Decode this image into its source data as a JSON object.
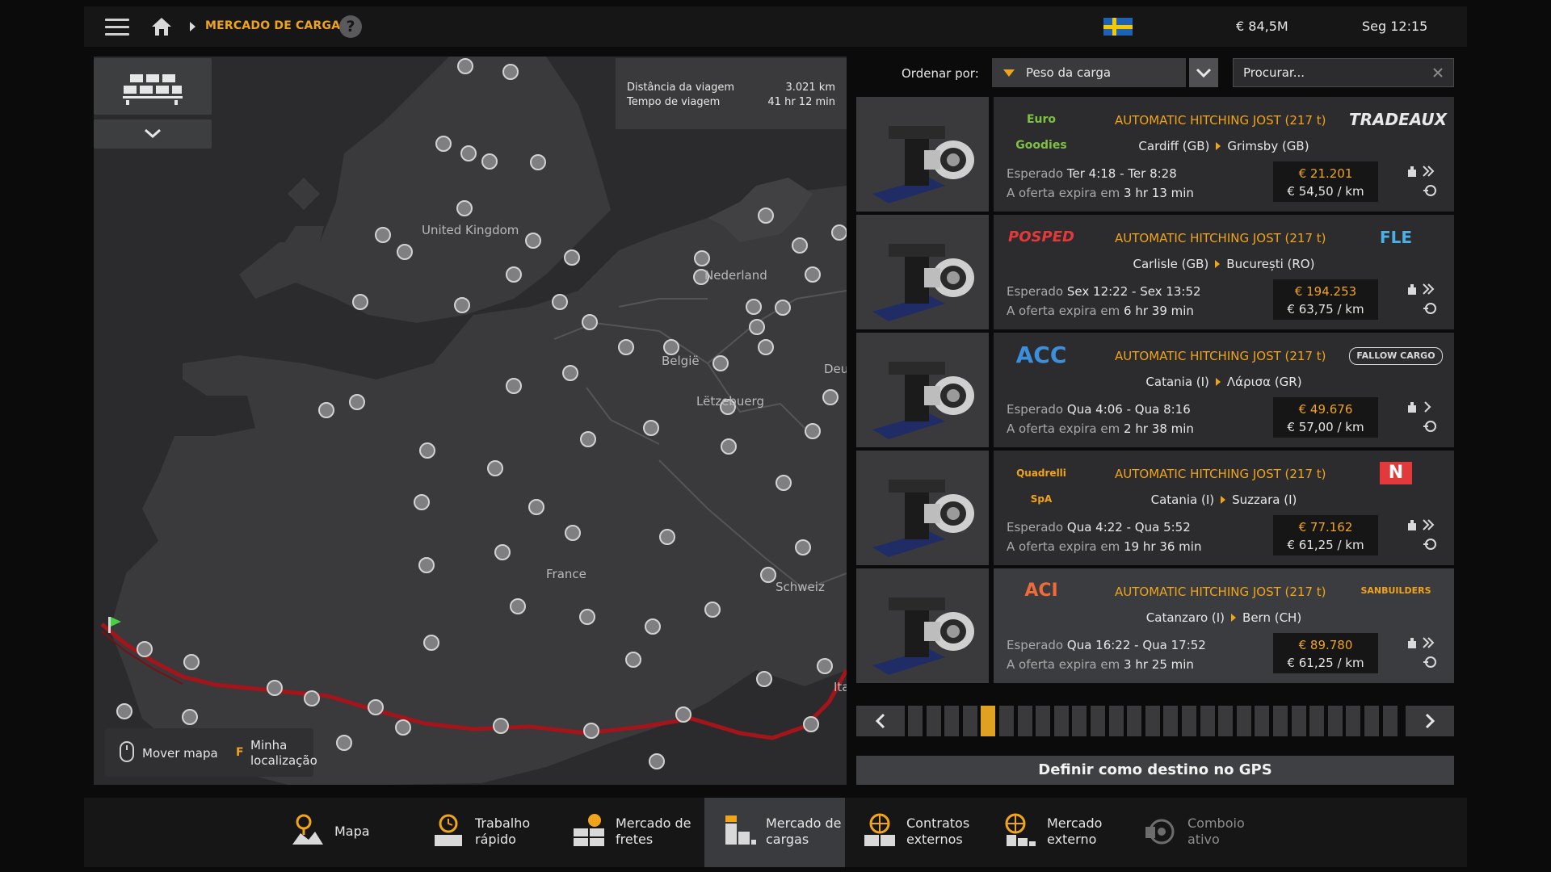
{
  "header": {
    "breadcrumb": "MERCADO DE CARGAS",
    "money": "€ 84,5M",
    "clock": "Seg 12:15"
  },
  "map": {
    "labels": {
      "uk": "United Kingdom",
      "nl": "Nederland",
      "be": "België",
      "lu": "Lëtzebuerg",
      "fr": "France",
      "ch": "Schweiz",
      "de": "Deu",
      "it": "Ita"
    },
    "route_info": {
      "distance_label": "Distância da viagem",
      "distance_value": "3.021 km",
      "time_label": "Tempo de viagem",
      "time_value": "41 hr 12 min"
    },
    "hints": {
      "move": "Mover mapa",
      "key": "F",
      "location": "Minha localização"
    }
  },
  "sort": {
    "label": "Ordenar por:",
    "value": "Peso da carga"
  },
  "search": {
    "placeholder": "Procurar..."
  },
  "jobs": [
    {
      "logo_left": "Euro Goodies",
      "logo_left_color": "#7fc242",
      "cargo": "AUTOMATIC HITCHING JOST (217 t)",
      "from": "Cardiff (GB)",
      "to": "Grimsby (GB)",
      "expected_label": "Esperado",
      "expected": "Ter 4:18 - Ter 8:28",
      "expire_label": "A oferta expira em",
      "expire": "3 hr 13 min",
      "pay": "€ 21.201",
      "per_km": "€ 54,50 / km",
      "logo_right": "TRADEAUX",
      "logo_right_color": "#e8e8e8"
    },
    {
      "logo_left": "POSPED",
      "logo_left_color": "#e23a3a",
      "cargo": "AUTOMATIC HITCHING JOST (217 t)",
      "from": "Carlisle (GB)",
      "to": "București (RO)",
      "expected_label": "Esperado",
      "expected": "Sex 12:22 - Sex 13:52",
      "expire_label": "A oferta expira em",
      "expire": "6 hr 39 min",
      "pay": "€ 194.253",
      "per_km": "€ 63,75 / km",
      "logo_right": "FLE",
      "logo_right_color": "#4ab0e6"
    },
    {
      "logo_left": "ACC",
      "logo_left_color": "#3c8fdc",
      "cargo": "AUTOMATIC HITCHING JOST (217 t)",
      "from": "Catania (I)",
      "to": "Λάρισα (GR)",
      "expected_label": "Esperado",
      "expected": "Qua 4:06 - Qua 8:16",
      "expire_label": "A oferta expira em",
      "expire": "2 hr 38 min",
      "pay": "€ 49.676",
      "per_km": "€ 57,00 / km",
      "logo_right": "FALLOW CARGO",
      "logo_right_color": "#d8d8d8"
    },
    {
      "logo_left": "Quadrelli SpA",
      "logo_left_color": "#f0a41b",
      "cargo": "AUTOMATIC HITCHING JOST (217 t)",
      "from": "Catania (I)",
      "to": "Suzzara (I)",
      "expected_label": "Esperado",
      "expected": "Qua 4:22 - Qua 5:52",
      "expire_label": "A oferta expira em",
      "expire": "19 hr 36 min",
      "pay": "€ 77.162",
      "per_km": "€ 61,25 / km",
      "logo_right": "N",
      "logo_right_color": "#e23a3a"
    },
    {
      "logo_left": "ACI",
      "logo_left_color": "#f06a3a",
      "cargo": "AUTOMATIC HITCHING JOST (217 t)",
      "from": "Catanzaro (I)",
      "to": "Bern (CH)",
      "expected_label": "Esperado",
      "expected": "Qua 16:22 - Qua 17:52",
      "expire_label": "A oferta expira em",
      "expire": "3 hr 25 min",
      "pay": "€ 89.780",
      "per_km": "€ 61,25 / km",
      "logo_right": "SANBUILDERS",
      "logo_right_color": "#f0a41b"
    }
  ],
  "pager": {
    "segments": 27,
    "current": 4
  },
  "gps_button": "Definir como destino no GPS",
  "nav": [
    {
      "label": "Mapa",
      "icon": "map-icon"
    },
    {
      "label": "Trabalho\nrápido",
      "icon": "quick-job-icon"
    },
    {
      "label": "Mercado de\nfretes",
      "icon": "freight-market-icon"
    },
    {
      "label": "Mercado de\ncargas",
      "icon": "cargo-market-icon"
    },
    {
      "label": "Contratos\nexternos",
      "icon": "external-contracts-icon"
    },
    {
      "label": "Mercado\nexterno",
      "icon": "external-market-icon"
    },
    {
      "label": "Comboio\nativo",
      "icon": "convoy-icon"
    }
  ],
  "colors": {
    "accent": "#f0a41b",
    "route": "#a3151a",
    "panel": "#2c2c2e"
  }
}
